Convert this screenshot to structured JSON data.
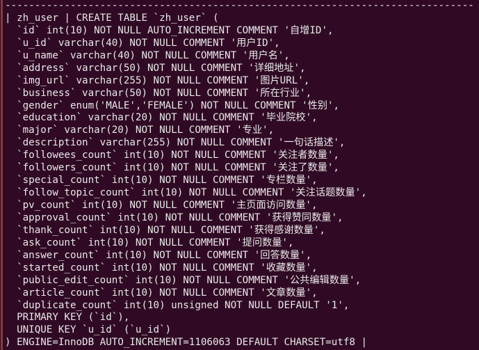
{
  "terminal": {
    "title": "mysql-show-create-table-output",
    "colors": {
      "background": "#300a24",
      "foreground": "#e8e8e8",
      "scrollbar": "#8a3a3a"
    },
    "lines": [
      "-------------------------------------------------------------------------------",
      "| zh_user | CREATE TABLE `zh_user` (",
      "  `id` int(10) NOT NULL AUTO_INCREMENT COMMENT '自增ID',",
      "  `u_id` varchar(40) NOT NULL COMMENT '用户ID',",
      "  `u_name` varchar(40) NOT NULL COMMENT '用户名',",
      "  `address` varchar(50) NOT NULL COMMENT '详细地址',",
      "  `img_url` varchar(255) NOT NULL COMMENT '图片URL',",
      "  `business` varchar(50) NOT NULL COMMENT '所在行业',",
      "  `gender` enum('MALE','FEMALE') NOT NULL COMMENT '性别',",
      "  `education` varchar(20) NOT NULL COMMENT '毕业院校',",
      "  `major` varchar(20) NOT NULL COMMENT '专业',",
      "  `description` varchar(255) NOT NULL COMMENT '一句话描述',",
      "  `followees_count` int(10) NOT NULL COMMENT '关注者数量',",
      "  `followers_count` int(10) NOT NULL COMMENT '关注了数量',",
      "  `special_count` int(10) NOT NULL COMMENT '专栏数量',",
      "  `follow_topic_count` int(10) NOT NULL COMMENT '关注话题数量',",
      "  `pv_count` int(10) NOT NULL COMMENT '主页面访问数量',",
      "  `approval_count` int(10) NOT NULL COMMENT '获得赞同数量',",
      "  `thank_count` int(10) NOT NULL COMMENT '获得感谢数量',",
      "  `ask_count` int(10) NOT NULL COMMENT '提问数量',",
      "  `answer_count` int(10) NOT NULL COMMENT '回答数量',",
      "  `started_count` int(10) NOT NULL COMMENT '收藏数量',",
      "  `public_edit_count` int(10) NOT NULL COMMENT '公共编辑数量',",
      "  `article_count` int(10) NOT NULL COMMENT '文章数量',",
      "  `duplicate_count` int(10) unsigned NOT NULL DEFAULT '1',",
      "  PRIMARY KEY (`id`),",
      "  UNIQUE KEY `u_id` (`u_id`)",
      ") ENGINE=InnoDB AUTO_INCREMENT=1106063 DEFAULT CHARSET=utf8 |"
    ]
  },
  "sql_schema": {
    "table_name": "zh_user",
    "statement_type": "CREATE TABLE",
    "engine": "InnoDB",
    "auto_increment": "1106063",
    "default_charset": "utf8",
    "columns": [
      {
        "name": "id",
        "type": "int(10)",
        "nullable": "NOT NULL",
        "extra": "AUTO_INCREMENT",
        "comment": "自增ID"
      },
      {
        "name": "u_id",
        "type": "varchar(40)",
        "nullable": "NOT NULL",
        "extra": "",
        "comment": "用户ID"
      },
      {
        "name": "u_name",
        "type": "varchar(40)",
        "nullable": "NOT NULL",
        "extra": "",
        "comment": "用户名"
      },
      {
        "name": "address",
        "type": "varchar(50)",
        "nullable": "NOT NULL",
        "extra": "",
        "comment": "详细地址"
      },
      {
        "name": "img_url",
        "type": "varchar(255)",
        "nullable": "NOT NULL",
        "extra": "",
        "comment": "图片URL"
      },
      {
        "name": "business",
        "type": "varchar(50)",
        "nullable": "NOT NULL",
        "extra": "",
        "comment": "所在行业"
      },
      {
        "name": "gender",
        "type": "enum('MALE','FEMALE')",
        "nullable": "NOT NULL",
        "extra": "",
        "comment": "性别"
      },
      {
        "name": "education",
        "type": "varchar(20)",
        "nullable": "NOT NULL",
        "extra": "",
        "comment": "毕业院校"
      },
      {
        "name": "major",
        "type": "varchar(20)",
        "nullable": "NOT NULL",
        "extra": "",
        "comment": "专业"
      },
      {
        "name": "description",
        "type": "varchar(255)",
        "nullable": "NOT NULL",
        "extra": "",
        "comment": "一句话描述"
      },
      {
        "name": "followees_count",
        "type": "int(10)",
        "nullable": "NOT NULL",
        "extra": "",
        "comment": "关注者数量"
      },
      {
        "name": "followers_count",
        "type": "int(10)",
        "nullable": "NOT NULL",
        "extra": "",
        "comment": "关注了数量"
      },
      {
        "name": "special_count",
        "type": "int(10)",
        "nullable": "NOT NULL",
        "extra": "",
        "comment": "专栏数量"
      },
      {
        "name": "follow_topic_count",
        "type": "int(10)",
        "nullable": "NOT NULL",
        "extra": "",
        "comment": "关注话题数量"
      },
      {
        "name": "pv_count",
        "type": "int(10)",
        "nullable": "NOT NULL",
        "extra": "",
        "comment": "主页面访问数量"
      },
      {
        "name": "approval_count",
        "type": "int(10)",
        "nullable": "NOT NULL",
        "extra": "",
        "comment": "获得赞同数量"
      },
      {
        "name": "thank_count",
        "type": "int(10)",
        "nullable": "NOT NULL",
        "extra": "",
        "comment": "获得感谢数量"
      },
      {
        "name": "ask_count",
        "type": "int(10)",
        "nullable": "NOT NULL",
        "extra": "",
        "comment": "提问数量"
      },
      {
        "name": "answer_count",
        "type": "int(10)",
        "nullable": "NOT NULL",
        "extra": "",
        "comment": "回答数量"
      },
      {
        "name": "started_count",
        "type": "int(10)",
        "nullable": "NOT NULL",
        "extra": "",
        "comment": "收藏数量"
      },
      {
        "name": "public_edit_count",
        "type": "int(10)",
        "nullable": "NOT NULL",
        "extra": "",
        "comment": "公共编辑数量"
      },
      {
        "name": "article_count",
        "type": "int(10)",
        "nullable": "NOT NULL",
        "extra": "",
        "comment": "文章数量"
      },
      {
        "name": "duplicate_count",
        "type": "int(10) unsigned",
        "nullable": "NOT NULL",
        "extra": "DEFAULT '1'",
        "comment": ""
      }
    ],
    "keys": [
      "PRIMARY KEY (`id`)",
      "UNIQUE KEY `u_id` (`u_id`)"
    ]
  }
}
